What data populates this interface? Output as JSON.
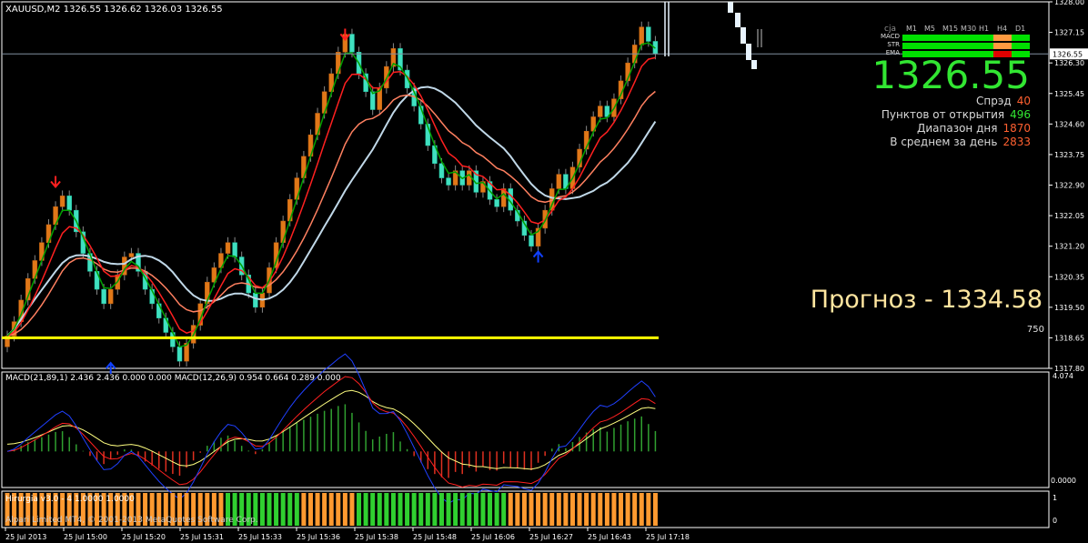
{
  "header": {
    "symbol_line": "XAUUSD,M2  1326.55 1326.62 1326.03 1326.55"
  },
  "panel": {
    "price": "1326.55",
    "stats": [
      {
        "label": "Спрэд",
        "value": "40",
        "color": "#ff6030"
      },
      {
        "label": "Пунктов от открытия",
        "value": "496",
        "color": "#32e632"
      },
      {
        "label": "Диапазон дня",
        "value": "1870",
        "color": "#ff6030"
      },
      {
        "label": "В среднем за день",
        "value": "2833",
        "color": "#ff6030"
      }
    ],
    "forecast": "Прогноз - 1334.58",
    "level_label": "750",
    "cja_label": "cja",
    "timeframes": [
      "M1",
      "M5",
      "M15",
      "M30",
      "H1",
      "H4",
      "D1"
    ],
    "rows": [
      {
        "name": "MACD",
        "colors": [
          "#00e000",
          "#00e000",
          "#00e000",
          "#00e000",
          "#00e000",
          "#ff9a40",
          "#00e000"
        ]
      },
      {
        "name": "STR",
        "colors": [
          "#00e000",
          "#00e000",
          "#00e000",
          "#00e000",
          "#00e000",
          "#ff9a40",
          "#00e000"
        ]
      },
      {
        "name": "EMA",
        "colors": [
          "#00e000",
          "#00e000",
          "#00e000",
          "#00e000",
          "#00e000",
          "#e00000",
          "#00e000"
        ]
      }
    ]
  },
  "macd": {
    "label": "MACD(21,89,1) 2.436 2.436 0.000 0.000  MACD(12,26,9) 0.954 0.664 0.289 0.000",
    "scale_top": "4.074",
    "scale_bottom": "0.0000"
  },
  "hirurgia": {
    "label": "Hirurgia v3.0 - 4 1.0000 1.0000",
    "copyright": "Alpari Limited MT4, © 2001-2013 MetaQuotes Software Corp.",
    "scale_top": "1",
    "scale_bottom": "0"
  },
  "chart_data": {
    "type": "candlestick",
    "symbol": "XAUUSD",
    "timeframe": "M2",
    "ohlc_current": {
      "open": 1326.55,
      "high": 1326.62,
      "low": 1326.03,
      "close": 1326.55
    },
    "ylim": [
      1317.8,
      1328.0
    ],
    "y_ticks": [
      1328.0,
      1327.15,
      1326.3,
      1325.45,
      1324.6,
      1323.75,
      1322.9,
      1322.05,
      1321.2,
      1320.35,
      1319.5,
      1318.65,
      1317.8
    ],
    "current_price_label": "1326.55",
    "x_ticks": [
      "25 Jul 2013",
      "25 Jul 15:00",
      "25 Jul 15:20",
      "25 Jul 15:31",
      "25 Jul 15:33",
      "25 Jul 15:36",
      "25 Jul 15:38",
      "25 Jul 15:48",
      "25 Jul 16:06",
      "25 Jul 16:27",
      "25 Jul 16:43",
      "25 Jul 17:18"
    ],
    "closes": [
      1318.7,
      1319.1,
      1319.7,
      1320.3,
      1320.8,
      1321.3,
      1321.8,
      1322.3,
      1322.6,
      1322.2,
      1321.6,
      1321.0,
      1320.5,
      1320.0,
      1319.6,
      1320.0,
      1320.4,
      1320.9,
      1321.0,
      1320.5,
      1320.0,
      1319.6,
      1319.2,
      1318.8,
      1318.4,
      1318.0,
      1318.5,
      1319.0,
      1319.6,
      1320.2,
      1320.6,
      1321.0,
      1321.3,
      1320.9,
      1320.4,
      1319.9,
      1319.5,
      1319.9,
      1320.6,
      1321.3,
      1321.9,
      1322.5,
      1323.1,
      1323.7,
      1324.3,
      1324.9,
      1325.5,
      1326.0,
      1326.6,
      1327.1,
      1326.6,
      1326.0,
      1325.5,
      1325.0,
      1325.6,
      1326.2,
      1326.7,
      1326.1,
      1325.6,
      1325.1,
      1324.6,
      1324.0,
      1323.5,
      1323.1,
      1322.9,
      1323.3,
      1322.9,
      1323.3,
      1322.7,
      1323.0,
      1322.5,
      1322.3,
      1322.8,
      1322.2,
      1321.9,
      1321.5,
      1321.2,
      1321.7,
      1322.2,
      1322.8,
      1323.2,
      1322.8,
      1323.4,
      1323.9,
      1324.4,
      1324.8,
      1325.1,
      1324.8,
      1325.3,
      1325.8,
      1326.3,
      1326.8,
      1327.3,
      1326.9,
      1326.55
    ],
    "series": [
      {
        "name": "EMA fast",
        "color": "#00a000"
      },
      {
        "name": "EMA mid",
        "color": "#ff2020"
      },
      {
        "name": "EMA slow",
        "color": "#ff8060"
      },
      {
        "name": "MA",
        "color": "#c0d8e8"
      }
    ],
    "horizontal_level": 1318.65,
    "arrows": [
      {
        "type": "sell",
        "index": 7,
        "price": 1322.9
      },
      {
        "type": "buy",
        "index": 15,
        "price": 1317.9
      },
      {
        "type": "sell",
        "index": 49,
        "price": 1327.0
      },
      {
        "type": "buy",
        "index": 77,
        "price": 1321.0
      }
    ]
  }
}
